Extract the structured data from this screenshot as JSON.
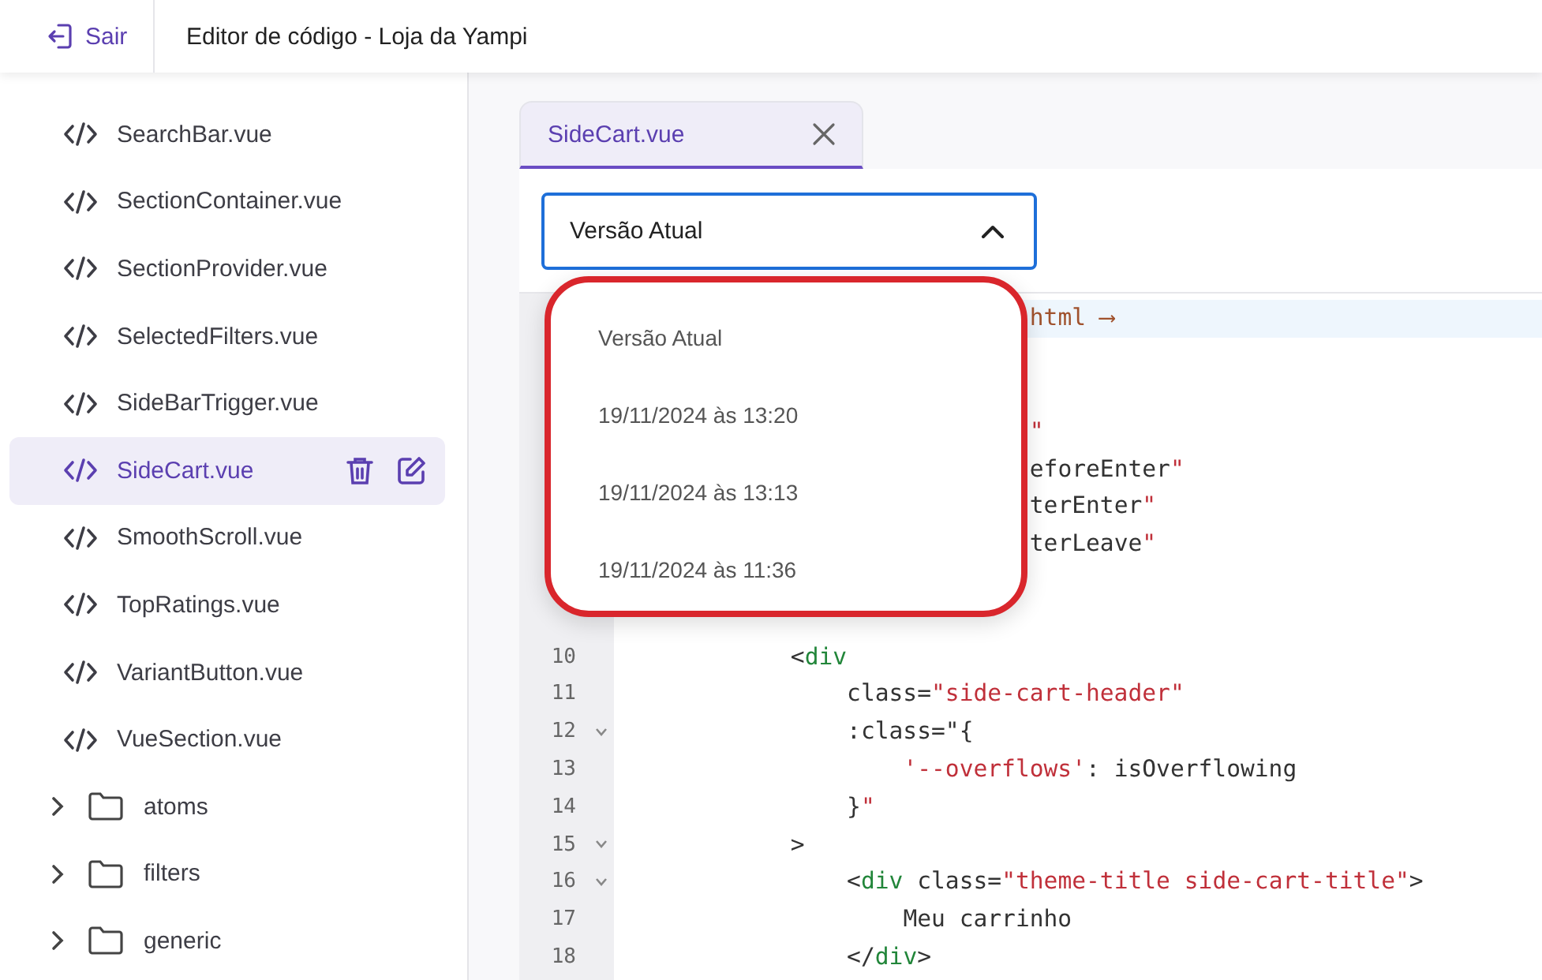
{
  "header": {
    "exit_label": "Sair",
    "title": "Editor de código - Loja da Yampi"
  },
  "sidebar": {
    "items": [
      {
        "kind": "file",
        "label": "SearchBar.vue",
        "selected": false
      },
      {
        "kind": "file",
        "label": "SectionContainer.vue",
        "selected": false
      },
      {
        "kind": "file",
        "label": "SectionProvider.vue",
        "selected": false
      },
      {
        "kind": "file",
        "label": "SelectedFilters.vue",
        "selected": false
      },
      {
        "kind": "file",
        "label": "SideBarTrigger.vue",
        "selected": false
      },
      {
        "kind": "file",
        "label": "SideCart.vue",
        "selected": true
      },
      {
        "kind": "file",
        "label": "SmoothScroll.vue",
        "selected": false
      },
      {
        "kind": "file",
        "label": "TopRatings.vue",
        "selected": false
      },
      {
        "kind": "file",
        "label": "VariantButton.vue",
        "selected": false
      },
      {
        "kind": "file",
        "label": "VueSection.vue",
        "selected": false
      },
      {
        "kind": "folder",
        "label": "atoms",
        "expanded": false
      },
      {
        "kind": "folder",
        "label": "filters",
        "expanded": false
      },
      {
        "kind": "folder",
        "label": "generic",
        "expanded": false
      }
    ]
  },
  "tabs": [
    {
      "label": "SideCart.vue",
      "selected": true
    }
  ],
  "version_select": {
    "value": "Versão Atual",
    "expanded": true,
    "options": [
      {
        "label": "Versão Atual"
      },
      {
        "label": "19/11/2024 às 13:20"
      },
      {
        "label": "19/11/2024 às 13:13"
      },
      {
        "label": "19/11/2024 às 11:36"
      }
    ]
  },
  "editor": {
    "lines": [
      {
        "active": true,
        "foldable": false,
        "tokens": [
          {
            "kind": "comment",
            "text": "html ⟶"
          }
        ]
      },
      {
        "active": false,
        "foldable": false
      },
      {
        "active": false,
        "foldable": false
      },
      {
        "active": false,
        "foldable": false,
        "tokens": [
          {
            "kind": "string",
            "text": "\""
          }
        ]
      },
      {
        "active": false,
        "foldable": false,
        "tokens": [
          {
            "kind": "plain",
            "text": "eforeEnter"
          },
          {
            "kind": "string",
            "text": "\""
          }
        ]
      },
      {
        "active": false,
        "foldable": false,
        "tokens": [
          {
            "kind": "plain",
            "text": "terEnter"
          },
          {
            "kind": "string",
            "text": "\""
          }
        ]
      },
      {
        "active": false,
        "foldable": false,
        "tokens": [
          {
            "kind": "plain",
            "text": "terLeave"
          },
          {
            "kind": "string",
            "text": "\""
          }
        ]
      },
      {
        "active": false,
        "foldable": false
      },
      {
        "active": false,
        "foldable": false
      },
      {
        "number": "10",
        "active": false,
        "foldable": false,
        "tokens": [
          {
            "kind": "plain",
            "text": "<"
          },
          {
            "kind": "tag",
            "text": "div"
          }
        ]
      },
      {
        "number": "11",
        "active": false,
        "foldable": false,
        "tokens": [
          {
            "kind": "plain",
            "text": "class="
          },
          {
            "kind": "string",
            "text": "\"side-cart-header\""
          }
        ]
      },
      {
        "number": "12",
        "active": false,
        "foldable": true,
        "tokens": [
          {
            "kind": "plain",
            "text": ":class=\"{"
          }
        ]
      },
      {
        "number": "13",
        "active": false,
        "foldable": false,
        "tokens": [
          {
            "kind": "string",
            "text": "'--overflows'"
          },
          {
            "kind": "plain",
            "text": ": isOverflowing"
          }
        ]
      },
      {
        "number": "14",
        "active": false,
        "foldable": false,
        "tokens": [
          {
            "kind": "plain",
            "text": "}"
          },
          {
            "kind": "string",
            "text": "\""
          }
        ]
      },
      {
        "number": "15",
        "active": false,
        "foldable": true,
        "tokens": [
          {
            "kind": "plain",
            "text": ">"
          }
        ]
      },
      {
        "number": "16",
        "active": false,
        "foldable": true,
        "tokens": [
          {
            "kind": "plain",
            "text": "<"
          },
          {
            "kind": "tag",
            "text": "div"
          },
          {
            "kind": "plain",
            "text": " class="
          },
          {
            "kind": "string",
            "text": "\"theme-title side-cart-title\""
          },
          {
            "kind": "plain",
            "text": ">"
          }
        ]
      },
      {
        "number": "17",
        "active": false,
        "foldable": false,
        "tokens": [
          {
            "kind": "plain",
            "text": "Meu carrinho"
          }
        ]
      },
      {
        "number": "18",
        "active": false,
        "foldable": false,
        "tokens": [
          {
            "kind": "plain",
            "text": "</"
          },
          {
            "kind": "tag",
            "text": "div"
          },
          {
            "kind": "plain",
            "text": ">"
          }
        ]
      }
    ]
  }
}
